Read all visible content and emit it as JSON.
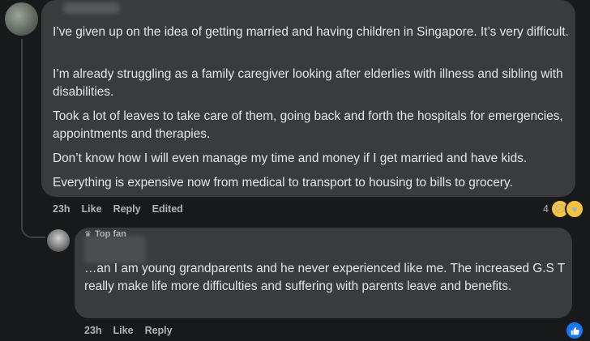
{
  "comment": {
    "paragraphs": [
      "I’ve given up on the idea of getting married and having children in Singapore. It’s very difficult.",
      "I’m already struggling as a family caregiver looking after elderlies with illness and sibling with disabilities.",
      "Took a lot of leaves to take care of them, going back and forth the hospitals for emergencies, appointments and therapies.",
      "Don’t know how I will even manage my time and money if I get married and have kids.",
      "Everything is expensive now from medical to transport to housing to bills to grocery."
    ],
    "time": "23h",
    "like_label": "Like",
    "reply_label": "Reply",
    "edited_label": "Edited",
    "reaction_count": "4",
    "reaction_icons": [
      "sad-emoji-icon",
      "care-emoji-icon"
    ]
  },
  "reply": {
    "badge": "Top fan",
    "text": "…an I am young grandparents and he never experienced like me. The increased G.S T really make life more difficulties and suffering with parents leave and benefits.",
    "time": "23h",
    "like_label": "Like",
    "reply_label": "Reply",
    "reaction_icon": "thumbs-up-icon",
    "accent": "#1877f2"
  }
}
